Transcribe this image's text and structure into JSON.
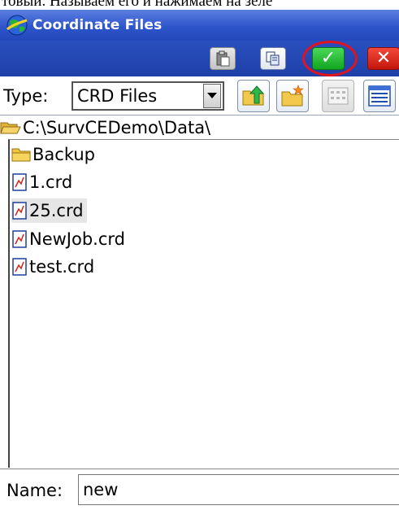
{
  "caption": "товый. Называем его и нажимаем на зелё",
  "window": {
    "title": "Coordinate Files"
  },
  "toolbar": {
    "icons": [
      "paste-icon",
      "copy-icon",
      "check-icon",
      "close-icon"
    ],
    "ok_glyph": "✓",
    "cancel_glyph": "✕"
  },
  "type_row": {
    "label": "Type:",
    "selected": "CRD Files",
    "icons": [
      "folder-up-icon",
      "new-folder-icon",
      "list-view-icon",
      "details-view-icon"
    ]
  },
  "path": "C:\\SurvCEDemo\\Data\\",
  "files": [
    {
      "name": "Backup",
      "icon": "folder-icon"
    },
    {
      "name": "1.crd",
      "icon": "crd-file-icon"
    },
    {
      "name": "25.crd",
      "icon": "crd-file-icon"
    },
    {
      "name": "NewJob.crd",
      "icon": "crd-file-icon"
    },
    {
      "name": "test.crd",
      "icon": "crd-file-icon"
    }
  ],
  "selected_file": "25.crd",
  "name_field": {
    "label": "Name:",
    "value": "new"
  },
  "colors": {
    "title_bar": "#2f55cc",
    "ok_button": "#1fb52c",
    "cancel_button": "#d9231a",
    "highlight_ring": "#e0141e"
  }
}
